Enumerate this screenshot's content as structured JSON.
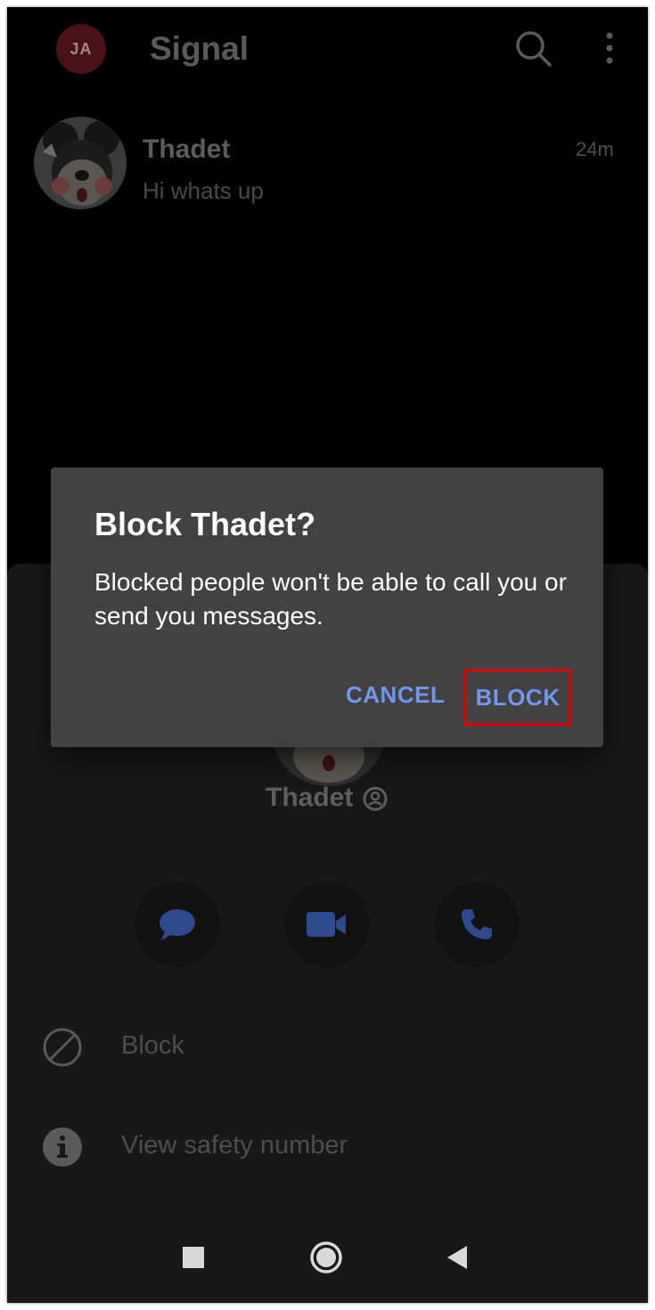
{
  "app": {
    "title": "Signal",
    "avatar_initials": "JA"
  },
  "conversation": {
    "name": "Thadet",
    "snippet": "Hi whats up",
    "time": "24m"
  },
  "sheet": {
    "name": "Thadet",
    "actions": [
      "message-icon",
      "video-call-icon",
      "phone-icon"
    ],
    "menu": [
      {
        "label": "Block",
        "icon": "block-icon"
      },
      {
        "label": "View safety number",
        "icon": "info-icon"
      }
    ]
  },
  "dialog": {
    "title": "Block Thadet?",
    "message": "Blocked people won't be able to call you or send you messages.",
    "cancel_label": "CANCEL",
    "block_label": "BLOCK"
  },
  "colors": {
    "accent": "#6f97f0",
    "highlight": "#e00000",
    "dialog_bg": "#424242"
  }
}
